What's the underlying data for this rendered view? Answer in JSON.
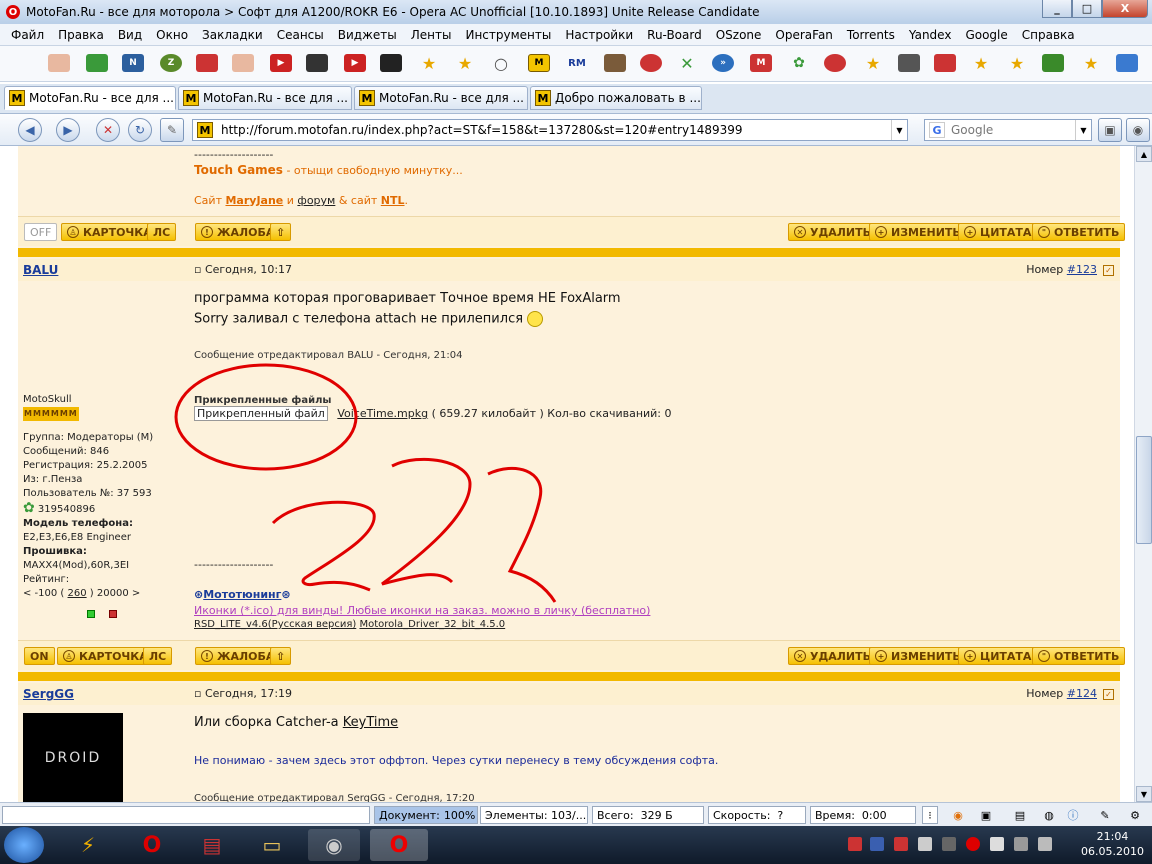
{
  "window": {
    "title": "MotoFan.Ru - все для моторола > Софт для A1200/ROKR E6 - Opera AC Unofficial [10.10.1893] Unite Release Candidate",
    "min": "_",
    "max": "□",
    "close": "X"
  },
  "menu": [
    "Файл",
    "Правка",
    "Вид",
    "Окно",
    "Закладки",
    "Сеансы",
    "Виджеты",
    "Ленты",
    "Инструменты",
    "Настройки",
    "Ru-Board",
    "OSzone",
    "OperaFan",
    "Torrents",
    "Yandex",
    "Google",
    "Справка"
  ],
  "tabs": [
    {
      "label": "MotoFan.Ru - все для ...",
      "active": true
    },
    {
      "label": "MotoFan.Ru - все для ...",
      "active": false
    },
    {
      "label": "MotoFan.Ru - все для ...",
      "active": false
    },
    {
      "label": "Добро пожаловать в ...",
      "active": false
    }
  ],
  "address": {
    "url": "http://forum.motofan.ru/index.php?act=ST&f=158&t=137280&st=120#entry1489399",
    "logo": "M"
  },
  "search": {
    "placeholder": "Google",
    "logo": "G"
  },
  "prev_post": {
    "dashes": "--------------------",
    "touch_games": "Touch Games",
    "touch_rest": " - отыщи свободную минутку...",
    "site": "Сайт ",
    "maryjane": "MaryJane",
    "and1": " и ",
    "forum": "форум",
    "and2": " & сайт ",
    "ntl": "NTL",
    "dot": "."
  },
  "buttons": {
    "off": "OFF",
    "on": "ON",
    "card": "КАРТОЧКА",
    "pm": "ЛС",
    "report": "ЖАЛОБА",
    "delete": "УДАЛИТЬ",
    "edit": "ИЗМЕНИТЬ",
    "quote": "ЦИТАТА",
    "reply": "ОТВЕТИТЬ"
  },
  "post123": {
    "author": "BALU",
    "time": "Сегодня, 10:17",
    "num_label": "Номер ",
    "num": "#123",
    "line1": "программа которая проговаривает Точное время НЕ FoxAlarm",
    "line2": "Sorry заливал с телефона attach не прилепился",
    "edited": "Сообщение отредактировал BALU - Сегодня, 21:04",
    "attach_title": "Прикрепленные файлы",
    "attach_label": "Прикрепленный файл",
    "attach_file": "VoiceTime.mpkg",
    "attach_size": " ( 659.27 килобайт ) Кол-во скачиваний: 0",
    "sig_dashes": "--------------------",
    "sig_tuning": "Мототюнинг",
    "sig_icons": "Иконки (*.ico) для винды! Любые иконки на заказ. можно в личку (бесплатно)",
    "sig_rsd": "RSD_LITE_v4.6(Русская версия)",
    "sig_driver": "Motorola_Driver_32_bit_4.5.0"
  },
  "profile123": {
    "title": "MotoSkull",
    "rank": "MMMMMM",
    "group": "Группа: Модераторы (M)",
    "posts": "Сообщений: 846",
    "reg": "Регистрация: 25.2.2005",
    "from": "Из: г.Пенза",
    "user_no": "Пользователь №: 37 593",
    "icq": "319540896",
    "phone_label": "Модель телефона:",
    "phones": "E2,E3,E6,E8 Engineer",
    "fw_label": "Прошивка:",
    "fw": "MAXX4(Mod),60R,3EI",
    "rating_label": "Рейтинг:",
    "rating_pre": "< -100 ( ",
    "rating_val": "260",
    "rating_post": " ) 20000 >"
  },
  "post124": {
    "author": "SergGG",
    "time": "Сегодня, 17:19",
    "num_label": "Номер ",
    "num": "#124",
    "line1_pre": "Или сборка Catcher-а ",
    "line1_link": "KeyTime",
    "mod_note": "Не понимаю - зачем здесь этот оффтоп. Через сутки перенесу в тему обсуждения софта.",
    "edited": "Сообщение отредактировал SergGG - Сегодня, 17:20",
    "avatar_text": "DROID"
  },
  "status": {
    "doc_label": "Документ:",
    "doc_val": "100%",
    "elem_label": "Элементы:",
    "elem_val": "103/...",
    "total_label": "Всего:",
    "total_val": "329 Б",
    "speed_label": "Скорость:",
    "speed_val": "?",
    "time_label": "Время:",
    "time_val": "0:00"
  },
  "clock": {
    "time": "21:04",
    "date": "06.05.2010"
  },
  "colors": {
    "page_bg": "#fdf2dc",
    "separator": "#f2b900",
    "button": "#f5c000",
    "link": "#1a3c9a",
    "annotation": "#e00000"
  }
}
